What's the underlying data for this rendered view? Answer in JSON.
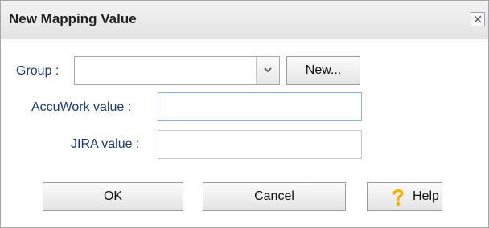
{
  "dialog": {
    "title": "New Mapping Value",
    "close_icon": "close-icon"
  },
  "form": {
    "group": {
      "label": "Group :",
      "value": "",
      "dropdown_icon": "chevron-down-icon",
      "new_button": "New..."
    },
    "accuwork": {
      "label": "AccuWork value :",
      "value": ""
    },
    "jira": {
      "label": "JIRA value :",
      "value": ""
    }
  },
  "buttons": {
    "ok": "OK",
    "cancel": "Cancel",
    "help": "Help",
    "help_icon": "question-mark-icon"
  },
  "colors": {
    "label_text": "#1b3a73",
    "titlebar": "#e8e8e8",
    "focused_border": "#93b3dd",
    "help_icon": "#f2b300"
  }
}
